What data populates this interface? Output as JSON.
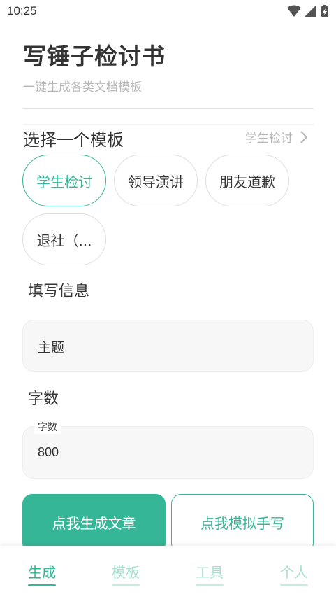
{
  "status_bar": {
    "time": "10:25",
    "icons": [
      "wifi-icon",
      "signal-icon",
      "battery-charging-icon"
    ]
  },
  "header": {
    "title": "写锤子检讨书",
    "subtitle": "一键生成各类文档模板"
  },
  "template_section": {
    "heading": "选择一个模板",
    "current": "学生检讨",
    "chips": [
      {
        "label": "学生检讨",
        "selected": true
      },
      {
        "label": "领导演讲",
        "selected": false
      },
      {
        "label": "朋友道歉",
        "selected": false
      },
      {
        "label": "退社（...",
        "selected": false
      }
    ]
  },
  "form": {
    "fill_heading": "填写信息",
    "topic_field": {
      "placeholder": "主题",
      "value": ""
    },
    "count_heading": "字数",
    "count_field": {
      "legend": "字数",
      "value": "800"
    }
  },
  "actions": {
    "generate": "点我生成文章",
    "handwrite": "点我模拟手写"
  },
  "bottom_nav": {
    "items": [
      {
        "label": "生成",
        "active": true
      },
      {
        "label": "模板",
        "active": false
      },
      {
        "label": "工具",
        "active": false
      },
      {
        "label": "个人",
        "active": false
      }
    ]
  },
  "colors": {
    "accent": "#35b697",
    "accent_light": "#a7dfd1",
    "border": "#dedede",
    "field_bg": "#f7f7f7"
  }
}
